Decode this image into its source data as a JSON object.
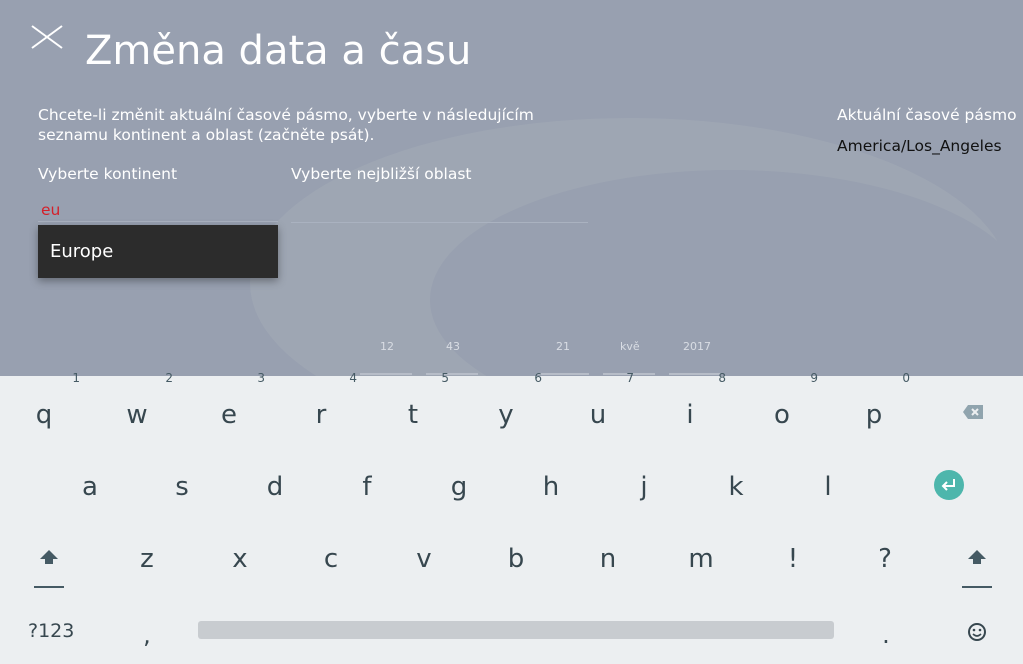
{
  "dialog": {
    "title": "Změna data a času",
    "instructions": "Chcete-li změnit aktuální časové pásmo, vyberte v následujícím seznamu kontinent a oblast (začněte psát).",
    "current_tz_label": "Aktuální časové pásmo",
    "current_tz_value": "America/Los_Angeles",
    "continent_label": "Vyberte kontinent",
    "area_label": "Vyberte nejbližší oblast",
    "continent_input_value": "eu",
    "area_input_value": "",
    "suggestions": [
      "Europe"
    ],
    "background_time": {
      "hour": "12",
      "minute": "43",
      "day": "21",
      "month": "kvě",
      "year": "2017"
    }
  },
  "keyboard": {
    "row1": [
      {
        "key": "q",
        "hint": "1"
      },
      {
        "key": "w",
        "hint": "2"
      },
      {
        "key": "e",
        "hint": "3"
      },
      {
        "key": "r",
        "hint": "4"
      },
      {
        "key": "t",
        "hint": "5"
      },
      {
        "key": "y",
        "hint": "6"
      },
      {
        "key": "u",
        "hint": "7"
      },
      {
        "key": "i",
        "hint": "8"
      },
      {
        "key": "o",
        "hint": "9"
      },
      {
        "key": "p",
        "hint": "0"
      }
    ],
    "row2": [
      "a",
      "s",
      "d",
      "f",
      "g",
      "h",
      "j",
      "k",
      "l"
    ],
    "row3": [
      "z",
      "x",
      "c",
      "v",
      "b",
      "n",
      "m",
      "!",
      "?"
    ],
    "symbols_label": "?123",
    "comma": ",",
    "period": "."
  },
  "colors": {
    "dialog_bg": "#98a0b0",
    "dropdown_bg": "#2c2c2c",
    "input_text": "#d4202a",
    "keyboard_bg": "#eceff1",
    "enter_key": "#4db6ac"
  },
  "icons": [
    "close-icon",
    "backspace-icon",
    "enter-icon",
    "shift-icon",
    "emoji-icon"
  ]
}
